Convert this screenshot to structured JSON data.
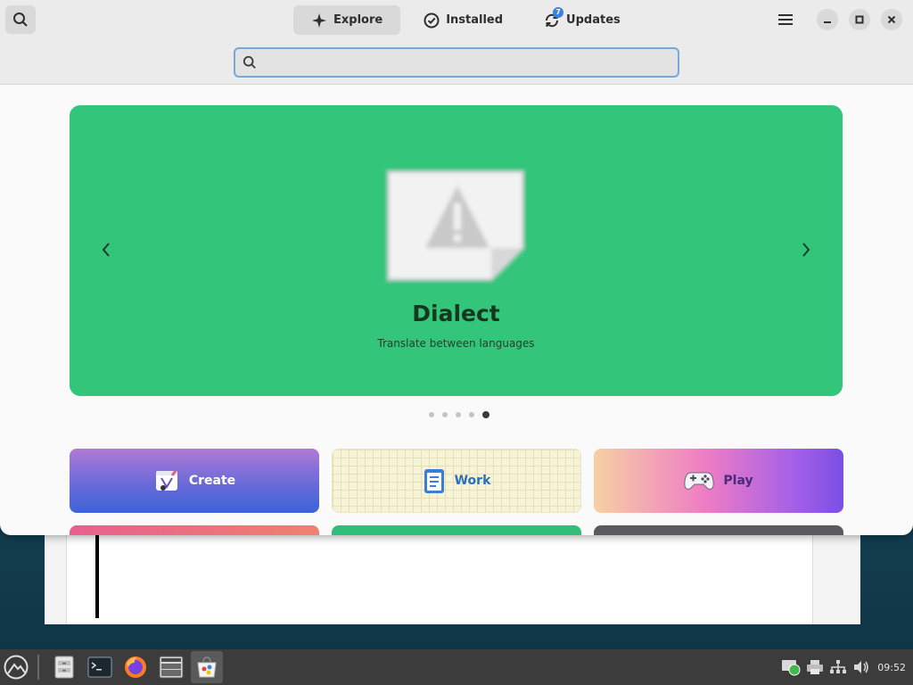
{
  "window": {
    "tabs": [
      {
        "label": "Explore",
        "icon": "sparkle-icon",
        "active": true
      },
      {
        "label": "Installed",
        "icon": "check-circle-icon",
        "active": false
      },
      {
        "label": "Updates",
        "icon": "refresh-icon",
        "active": false,
        "badge": "7"
      }
    ],
    "search": {
      "value": "",
      "placeholder": ""
    }
  },
  "featured": {
    "app_name": "Dialect",
    "description": "Translate between languages",
    "background_color": "#33c57a",
    "page_count": 5,
    "active_page": 5
  },
  "categories": [
    {
      "label": "Create",
      "icon": "create-icon"
    },
    {
      "label": "Work",
      "icon": "clipboard-icon"
    },
    {
      "label": "Play",
      "icon": "gamepad-icon"
    }
  ],
  "taskbar": {
    "apps": [
      "file-cabinet-icon",
      "terminal-icon",
      "firefox-icon",
      "window-manager-icon",
      "software-store-icon"
    ],
    "clock": "09:52"
  }
}
